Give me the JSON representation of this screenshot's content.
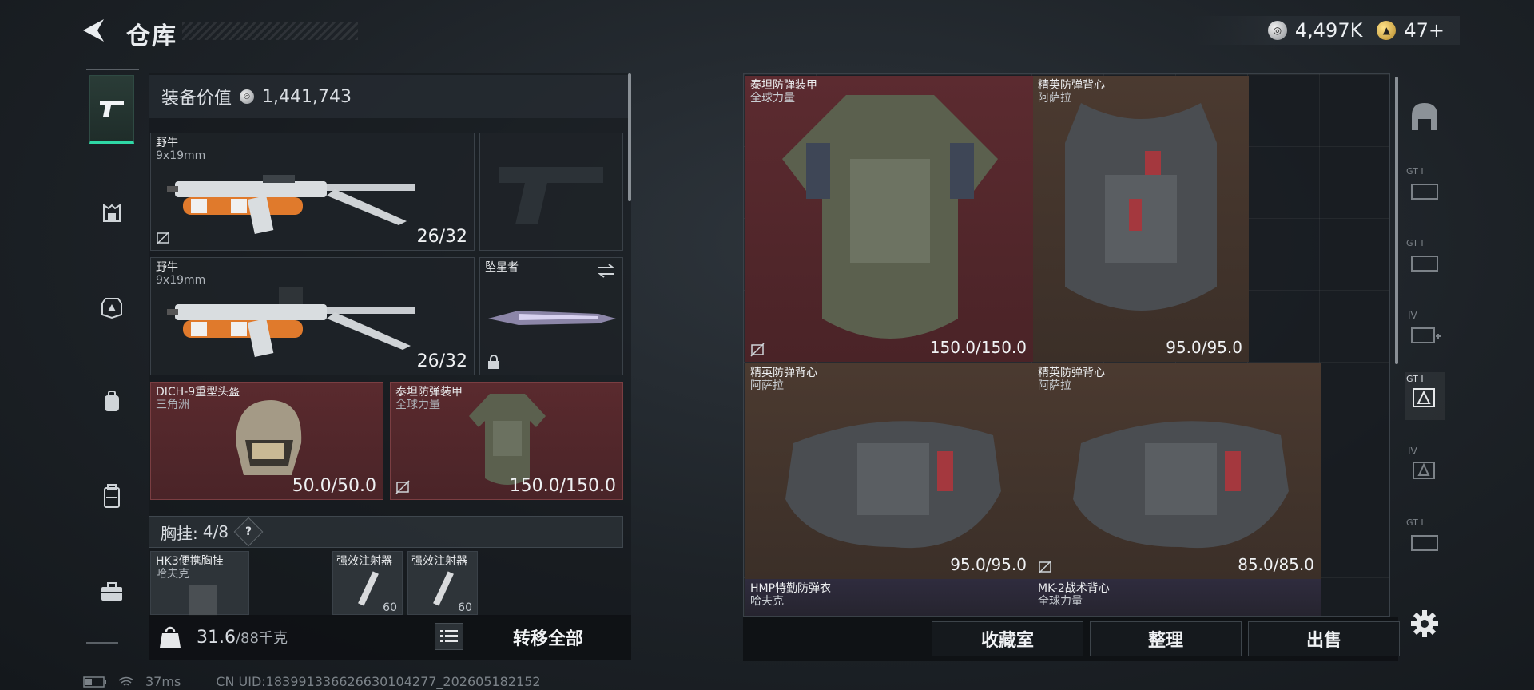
{
  "header": {
    "title": "仓库",
    "currency": [
      {
        "icon": "silver-coin-icon",
        "value": "4,497K"
      },
      {
        "icon": "gold-coin-icon",
        "value": "47+"
      }
    ]
  },
  "left_nav": {
    "items": [
      {
        "icon": "pistol-icon",
        "active": true
      },
      {
        "icon": "helmet-icon",
        "active": false
      },
      {
        "icon": "armor-icon",
        "active": false
      },
      {
        "icon": "backpack-icon",
        "active": false
      },
      {
        "icon": "chest-rig-icon",
        "active": false
      },
      {
        "icon": "toolbox-icon",
        "active": false
      }
    ]
  },
  "loadout": {
    "equip_value_label": "装备价值",
    "equip_value": "1,441,743",
    "primary_weapon": {
      "name": "野牛",
      "caliber": "9x19mm",
      "ammo": "26/32"
    },
    "secondary_weapon": {
      "name": "野牛",
      "caliber": "9x19mm",
      "ammo": "26/32"
    },
    "melee": {
      "name": "坠星者"
    },
    "helmet": {
      "name": "DICH-9重型头盔",
      "faction": "三角洲",
      "durability": "50.0/50.0"
    },
    "armor": {
      "name": "泰坦防弹装甲",
      "faction": "全球力量",
      "durability": "150.0/150.0"
    },
    "chest_rig_label": "胸挂:",
    "chest_rig_capacity": "4/8",
    "help": "?",
    "rig_item": {
      "name": "HK3便携胸挂",
      "faction": "哈夫克"
    },
    "consumables": [
      {
        "name": "强效注射器",
        "count": "60"
      },
      {
        "name": "强效注射器",
        "count": "60"
      }
    ],
    "weight": "31.6",
    "weight_max": "/88千克",
    "transfer_all": "转移全部"
  },
  "storage": {
    "items": [
      {
        "name": "泰坦防弹装甲",
        "faction": "全球力量",
        "durability": "150.0/150.0",
        "rarity": "red"
      },
      {
        "name": "精英防弹背心",
        "faction": "阿萨拉",
        "durability": "95.0/95.0",
        "rarity": "brown"
      },
      {
        "name": "精英防弹背心",
        "faction": "阿萨拉",
        "durability": "95.0/95.0",
        "rarity": "brown"
      },
      {
        "name": "精英防弹背心",
        "faction": "阿萨拉",
        "durability": "85.0/85.0",
        "rarity": "brown"
      },
      {
        "name": "HMP特勤防弹衣",
        "faction": "哈夫克",
        "rarity": "purple"
      },
      {
        "name": "MK-2战术背心",
        "faction": "全球力量",
        "rarity": "purple"
      }
    ],
    "buttons": {
      "collection": "收藏室",
      "sort": "整理",
      "sell": "出售"
    }
  },
  "right_nav": {
    "items": [
      {
        "label": "",
        "icon": "helmet-filter-icon"
      },
      {
        "label": "GT I",
        "icon": "armor-tier-filter-icon"
      },
      {
        "label": "GT I",
        "icon": "weapon-tier-filter-icon"
      },
      {
        "label": "IV",
        "icon": "medkit-filter-icon"
      },
      {
        "label": "GT I",
        "icon": "ammo-filter-icon",
        "active": true
      },
      {
        "label": "IV",
        "icon": "key-filter-icon"
      },
      {
        "label": "GT I",
        "icon": "misc-filter-icon"
      }
    ]
  },
  "status": {
    "ping": "37ms",
    "uid": "CN UID:183991336626630104277_202605182152"
  },
  "colors": {
    "accent": "#2fd8a6",
    "rarity_red": "#5c2b30",
    "rarity_brown": "#4b3a30",
    "rarity_purple": "#2f2c3e"
  }
}
